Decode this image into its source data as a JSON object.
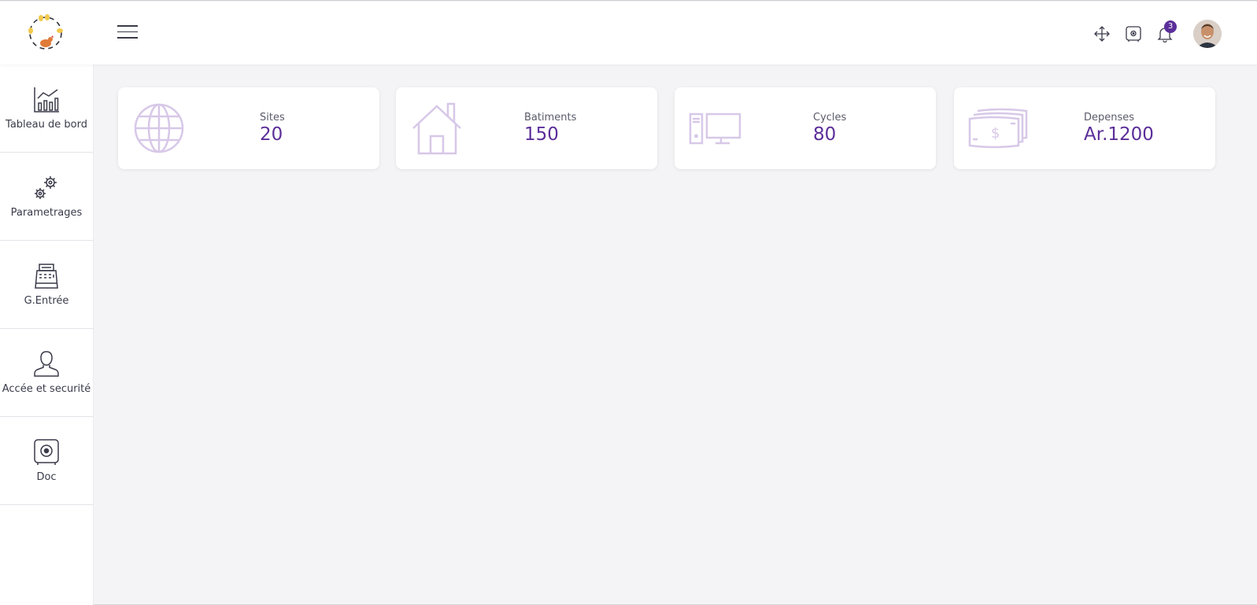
{
  "header": {
    "notification_count": "3"
  },
  "sidebar": {
    "items": [
      {
        "label": "Tableau de bord",
        "icon": "chart-icon"
      },
      {
        "label": "Parametrages",
        "icon": "gears-icon"
      },
      {
        "label": "G.Entrée",
        "icon": "cash-register-icon"
      },
      {
        "label": "Accée et securité",
        "icon": "user-icon"
      },
      {
        "label": "Doc",
        "icon": "safe-icon"
      }
    ]
  },
  "cards": [
    {
      "label": "Sites",
      "value": "20",
      "icon": "globe-icon"
    },
    {
      "label": "Batiments",
      "value": "150",
      "icon": "house-icon"
    },
    {
      "label": "Cycles",
      "value": "80",
      "icon": "computer-icon"
    },
    {
      "label": "Depenses",
      "value": "Ar.1200",
      "icon": "money-icon"
    }
  ],
  "colors": {
    "accent": "#5b2e99",
    "icon_light": "#d7c8e8",
    "text": "#3a3a4a"
  }
}
